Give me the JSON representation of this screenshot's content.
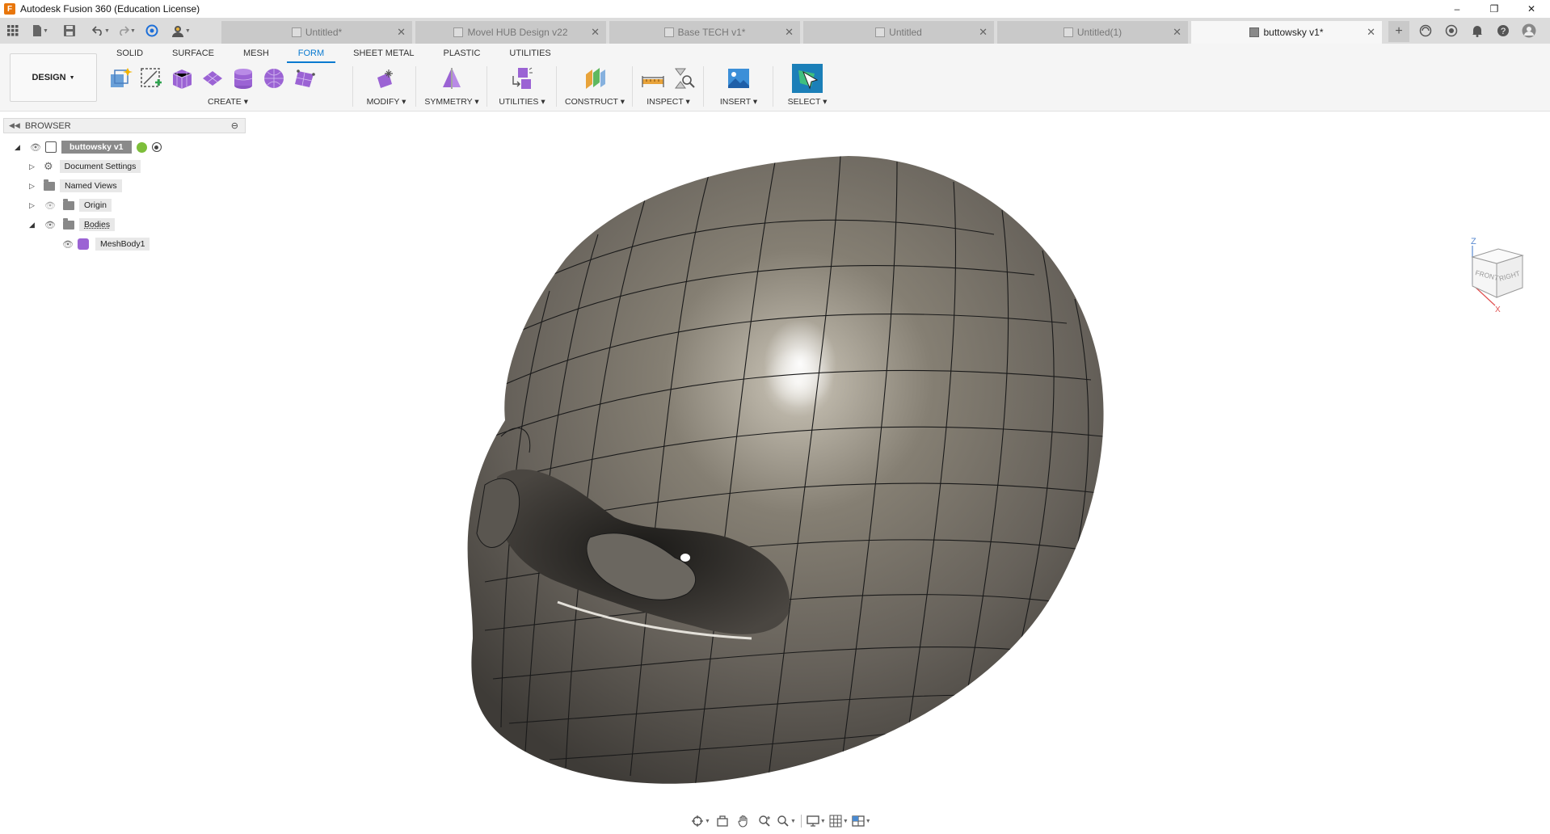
{
  "app": {
    "logo_letter": "F",
    "title": "Autodesk Fusion 360 (Education License)",
    "window_buttons": [
      "–",
      "❐",
      "✕"
    ]
  },
  "tabs": [
    {
      "label": "Untitled*",
      "active": false
    },
    {
      "label": "Movel HUB Design v22",
      "active": false
    },
    {
      "label": "Base TECH  v1*",
      "active": false
    },
    {
      "label": "Untitled",
      "active": false
    },
    {
      "label": "Untitled(1)",
      "active": false
    },
    {
      "label": "buttowsky v1*",
      "active": true
    }
  ],
  "tab_close": "✕",
  "toolbar_right_icons": [
    "plus-icon",
    "job-status-icon",
    "extensions-icon",
    "notifications-icon",
    "help-icon",
    "profile-icon"
  ],
  "ribbon": {
    "workspace": "DESIGN",
    "tabs": [
      {
        "label": "SOLID",
        "active": false
      },
      {
        "label": "SURFACE",
        "active": false
      },
      {
        "label": "MESH",
        "active": false
      },
      {
        "label": "FORM",
        "active": true
      },
      {
        "label": "SHEET METAL",
        "active": false
      },
      {
        "label": "PLASTIC",
        "active": false
      },
      {
        "label": "UTILITIES",
        "active": false
      }
    ],
    "groups": {
      "create": "CREATE",
      "modify": "MODIFY",
      "symmetry": "SYMMETRY",
      "utilities": "UTILITIES",
      "construct": "CONSTRUCT",
      "inspect": "INSPECT",
      "insert": "INSERT",
      "select": "SELECT"
    },
    "dropdown_caret": "▾"
  },
  "browser": {
    "title": "BROWSER",
    "root": "buttowsky v1",
    "items": [
      {
        "label": "Document Settings",
        "icon": "gear-icon"
      },
      {
        "label": "Named Views",
        "icon": "folder-icon"
      },
      {
        "label": "Origin",
        "icon": "folder-icon"
      },
      {
        "label": "Bodies",
        "icon": "folder-icon"
      },
      {
        "label": "MeshBody1",
        "icon": "form-body-icon"
      }
    ]
  },
  "viewcube": {
    "front": "FRONT",
    "right": "RIGHT",
    "z": "Z",
    "x": "X"
  },
  "colors": {
    "accent": "#0a7ad0",
    "form_purple": "#9b63d4",
    "model_base": "#6e6a62"
  }
}
